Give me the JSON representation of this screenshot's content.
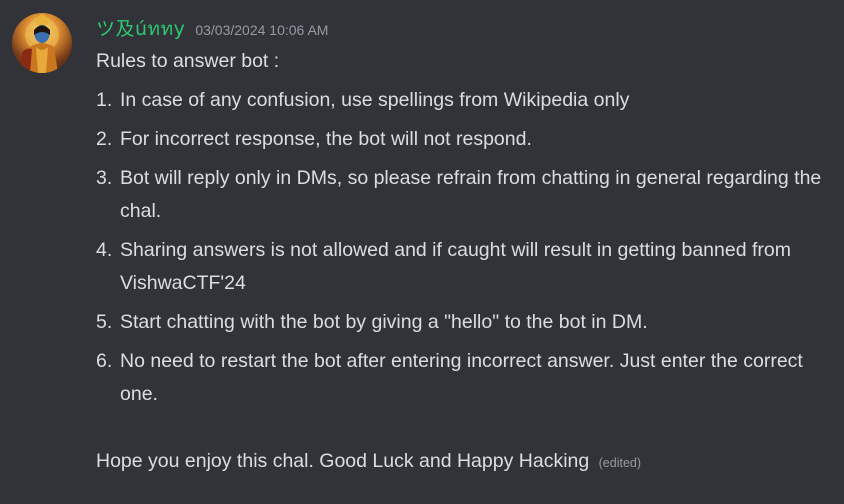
{
  "message": {
    "username": "ツ及úททy",
    "timestamp": "03/03/2024 10:06 AM",
    "intro": "Rules to answer bot :",
    "rules": [
      {
        "number": "1.",
        "text": "In case of any confusion, use spellings from Wikipedia only"
      },
      {
        "number": "2.",
        "text": "For incorrect response, the bot will not respond."
      },
      {
        "number": "3.",
        "text": "Bot will reply only in DMs, so please refrain from chatting in general regarding the chal."
      },
      {
        "number": "4.",
        "text": "Sharing answers is not allowed and if caught will result in getting banned from VishwaCTF'24"
      },
      {
        "number": "5.",
        "text": "Start chatting with the bot by giving a \"hello\" to the bot in DM."
      },
      {
        "number": "6.",
        "text": "No need to restart the bot after entering incorrect answer. Just enter the correct one."
      }
    ],
    "closing": "Hope you enjoy this chal. Good Luck and Happy Hacking",
    "edited_label": "(edited)"
  },
  "colors": {
    "background": "#313338",
    "username": "#2dc770",
    "text": "#dbdee1",
    "muted": "#949ba4"
  }
}
